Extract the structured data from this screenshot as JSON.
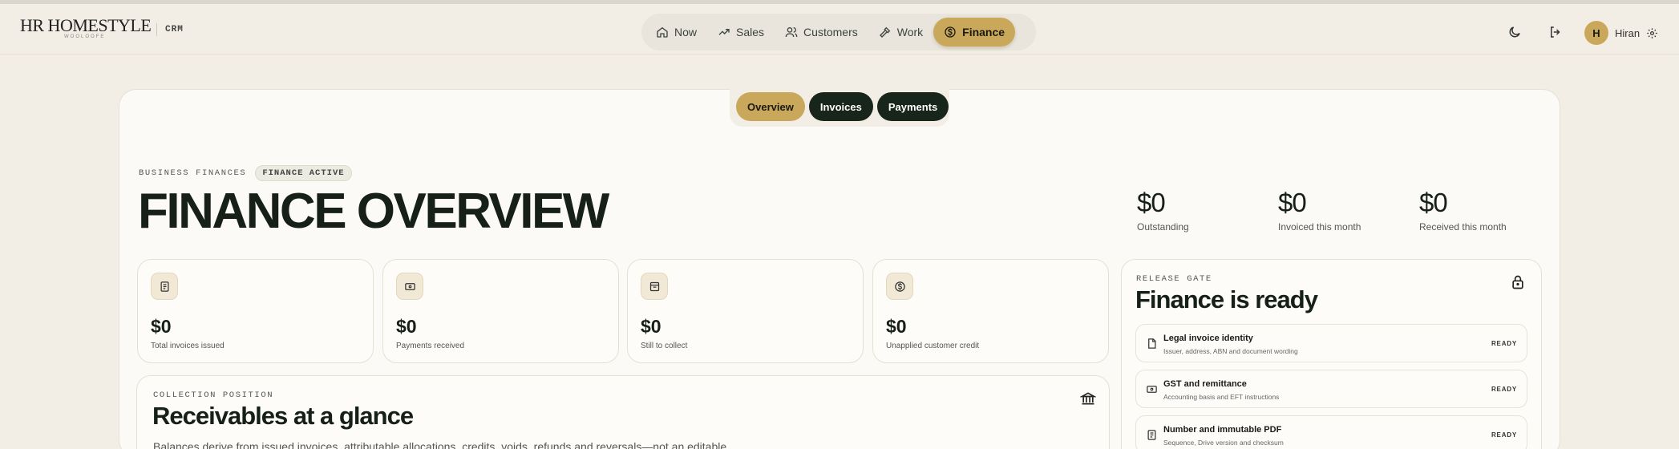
{
  "header": {
    "logo": "HR HOMESTYLE",
    "logo_sub": "WOOLOOFE",
    "app_label": "CRM",
    "nav": [
      {
        "label": "Now",
        "icon": "home-icon"
      },
      {
        "label": "Sales",
        "icon": "trend-up-icon"
      },
      {
        "label": "Customers",
        "icon": "users-icon"
      },
      {
        "label": "Work",
        "icon": "hammer-icon"
      },
      {
        "label": "Finance",
        "icon": "dollar-circle-icon",
        "active": true
      }
    ],
    "user": {
      "initial": "H",
      "name": "Hiran"
    }
  },
  "subtabs": [
    {
      "label": "Overview",
      "active": true
    },
    {
      "label": "Invoices"
    },
    {
      "label": "Payments"
    }
  ],
  "page": {
    "eyebrow": "BUSINESS FINANCES",
    "status_pill": "FINANCE ACTIVE",
    "title": "FINANCE OVERVIEW"
  },
  "stats": [
    {
      "value": "$0",
      "label": "Outstanding"
    },
    {
      "value": "$0",
      "label": "Invoiced this month"
    },
    {
      "value": "$0",
      "label": "Received this month"
    }
  ],
  "cards": [
    {
      "value": "$0",
      "label": "Total invoices issued",
      "icon": "document-icon"
    },
    {
      "value": "$0",
      "label": "Payments received",
      "icon": "cash-icon"
    },
    {
      "value": "$0",
      "label": "Still to collect",
      "icon": "inbox-icon"
    },
    {
      "value": "$0",
      "label": "Unapplied customer credit",
      "icon": "dollar-circle-icon"
    }
  ],
  "release_gate": {
    "eyebrow": "RELEASE GATE",
    "title": "Finance is ready",
    "items": [
      {
        "title": "Legal invoice identity",
        "sub": "Issuer, address, ABN and document wording",
        "status": "READY"
      },
      {
        "title": "GST and remittance",
        "sub": "Accounting basis and EFT instructions",
        "status": "READY"
      },
      {
        "title": "Number and immutable PDF",
        "sub": "Sequence, Drive version and checksum",
        "status": "READY"
      }
    ]
  },
  "receivables": {
    "eyebrow": "COLLECTION POSITION",
    "title": "Receivables at a glance",
    "text": "Balances derive from issued invoices, attributable allocations, credits, voids, refunds and reversals—not an editable"
  },
  "colors": {
    "accent": "#c9a85c",
    "dark": "#18251b",
    "background": "#f2eee5"
  }
}
